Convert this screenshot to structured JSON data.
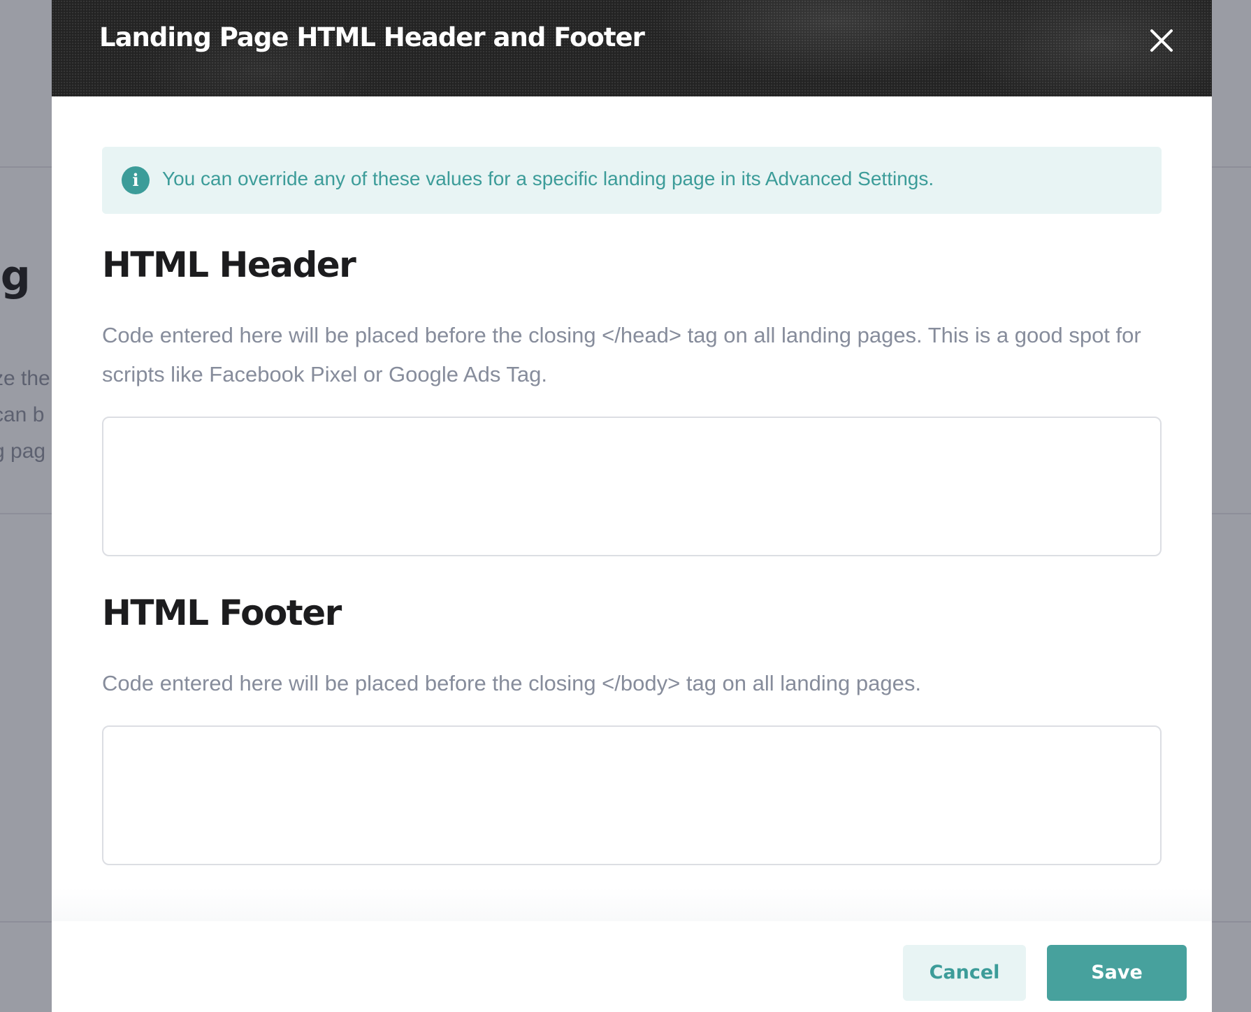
{
  "background": {
    "heading_fragment": "ng",
    "text_fragments": [
      "ze the",
      "can b",
      "g pag"
    ]
  },
  "modal": {
    "title": "Landing Page HTML Header and Footer",
    "close_icon": "close-icon",
    "info": {
      "icon": "info-icon",
      "icon_glyph": "i",
      "text": "You can override any of these values for a specific landing page in its Advanced Settings."
    },
    "header_section": {
      "title": "HTML Header",
      "description": "Code entered here will be placed before the closing </head> tag on all landing pages. This is a good spot for scripts like Facebook Pixel or Google Ads Tag.",
      "value": ""
    },
    "footer_section": {
      "title": "HTML Footer",
      "description": "Code entered here will be placed before the closing </body> tag on all landing pages.",
      "value": ""
    },
    "buttons": {
      "cancel": "Cancel",
      "save": "Save"
    }
  },
  "colors": {
    "accent": "#47a19d",
    "accent_text": "#3c9c99",
    "info_bg": "#e8f4f4",
    "header_bg": "#232323"
  }
}
